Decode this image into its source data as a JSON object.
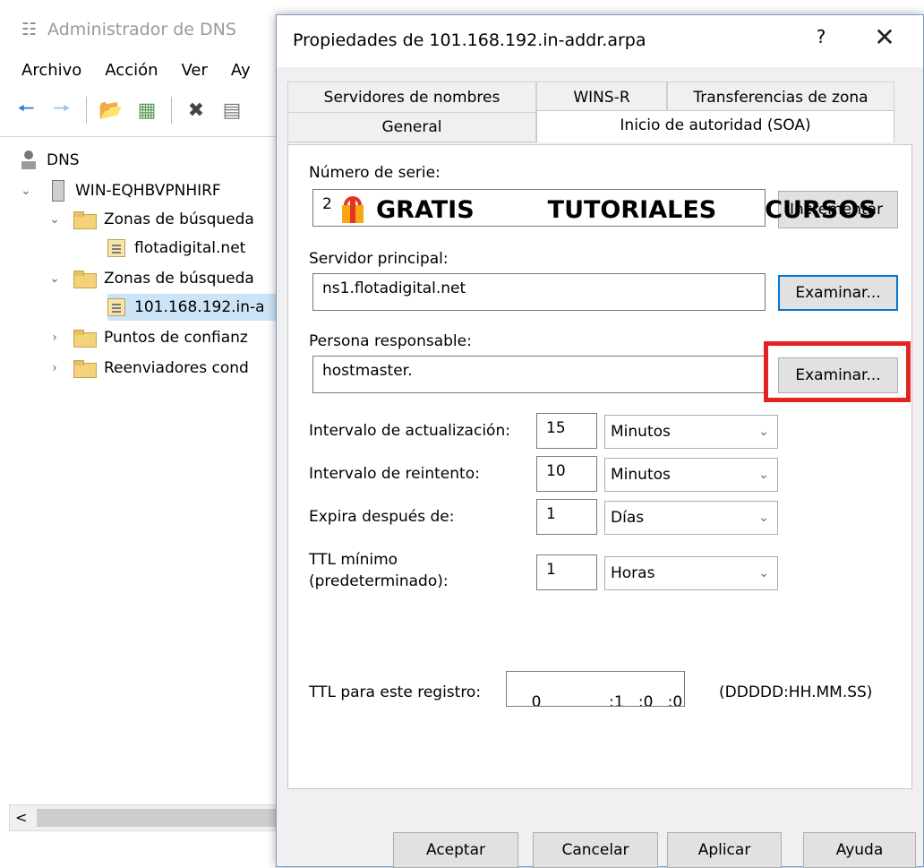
{
  "mmc": {
    "title": "Administrador de DNS",
    "menu": [
      "Archivo",
      "Acción",
      "Ver",
      "Ay"
    ],
    "tree": {
      "root": "DNS",
      "server": "WIN-EQHBVPNHIRF",
      "forward": "Zonas de búsqueda",
      "forward_child": "flotadigital.net",
      "reverse": "Zonas de búsqueda",
      "reverse_child": "101.168.192.in-a",
      "trust": "Puntos de confianz",
      "forwarders": "Reenviadores cond"
    },
    "scroll_left": "<"
  },
  "dialog": {
    "title": "Propiedades de 101.168.192.in-addr.arpa",
    "help": "?",
    "close": "✕",
    "tabs_back": [
      "Servidores de nombres",
      "WINS-R",
      "Transferencias de zona"
    ],
    "tabs_front": [
      "General",
      "Inicio de autoridad (SOA)"
    ],
    "serial_label": "Número de serie:",
    "serial_value": "2",
    "increment_button": "Incrementar",
    "primary_label": "Servidor principal:",
    "primary_value": "ns1.flotadigital.net",
    "browse1": "Examinar...",
    "responsible_label": "Persona responsable:",
    "responsible_value": "hostmaster.",
    "browse2": "Examinar...",
    "rows": [
      {
        "label": "Intervalo de actualización:",
        "value": "15",
        "unit": "Minutos"
      },
      {
        "label": "Intervalo de reintento:",
        "value": "10",
        "unit": "Minutos"
      },
      {
        "label": "Expira después de:",
        "value": "1",
        "unit": "Días"
      },
      {
        "label": "TTL mínimo\n(predeterminado):",
        "value": "1",
        "unit": "Horas"
      }
    ],
    "ttl_label": "TTL para este registro:",
    "ttl_value": "0              :1   :0   :0",
    "ttl_format": "(DDDDD:HH.MM.SS)",
    "buttons": [
      "Aceptar",
      "Cancelar",
      "Aplicar",
      "Ayuda"
    ]
  },
  "overlay": {
    "gratis": "GRATIS",
    "tutoriales": "TUTORIALES",
    "cursos": "CURSOS"
  }
}
